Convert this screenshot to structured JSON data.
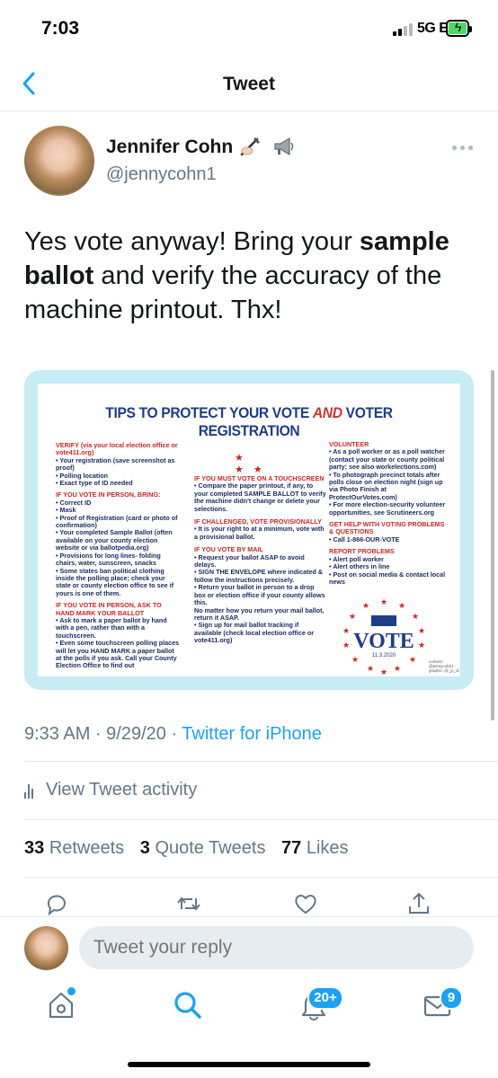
{
  "status_bar": {
    "time": "7:03",
    "network": "5G E"
  },
  "nav": {
    "title": "Tweet"
  },
  "tweet": {
    "author_name": "Jennifer Cohn",
    "author_handle": "@jennycohn1",
    "text_parts": [
      "Yes vote anyway!  Bring your ",
      "sample ballot",
      " and verify the accuracy of the machine printout. Thx!"
    ]
  },
  "image": {
    "title_part1": "TIPS TO PROTECT YOUR VOTE ",
    "title_and": "AND",
    "title_part2": " VOTER REGISTRATION",
    "col1": {
      "verify_head": "VERIFY (via your local election office or vote411.org)",
      "verify_items": [
        "•  Your registration (save screenshot as proof)",
        "•  Polling location",
        "•  Exact type of ID needed"
      ],
      "inperson_head": "IF YOU VOTE IN PERSON, BRING:",
      "inperson_items": [
        "•  Correct ID",
        "•  Mask",
        "•  Proof of Registration (card or photo of confirmation)",
        "•  Your completed Sample Ballot (often available on your county election website or via ballotpedia.org)",
        "•  Provisions for long lines- folding chairs, water, sunscreen, snacks",
        "•  Some states ban political clothing inside the polling place; check your state or county election office to see if yours is one of them."
      ],
      "handmark_head": "IF YOU VOTE IN PERSON, ASK TO HAND MARK YOUR BALLOT",
      "handmark_items": [
        "•  Ask to mark a paper ballot by hand with a pen, rather than with a touchscreen.",
        "•  Even some touchscreen polling places will let you HAND MARK a paper ballot at the polls if you ask. Call your County Election Office to find out"
      ]
    },
    "col2": {
      "touch_head": "IF YOU MUST VOTE ON A TOUCHSCREEN",
      "touch_items": [
        "•  Compare the paper printout, if any, to your completed SAMPLE BALLOT to verify the machine didn't change or delete your selections."
      ],
      "challenged_head": "IF CHALLENGED, VOTE PROVISIONALLY",
      "challenged_items": [
        "•  It is your right to at a minimum, vote with a provisional ballot."
      ],
      "mail_head": "IF YOU VOTE BY MAIL",
      "mail_items": [
        "•  Request your ballot ASAP to avoid delays.",
        "•  SIGN THE ENVELOPE where indicated & follow the instructions precisely.",
        "•  Return your ballot in person to a drop box or election office if your county allows this.",
        "No matter how you return your mail ballot, return it ASAP.",
        "•  Sign up for mail ballot tracking if available (check local election office or vote411.org)"
      ]
    },
    "col3": {
      "volunteer_head": "VOLUNTEER",
      "volunteer_items": [
        "•  As a poll worker or as a poll watcher (contact your state or county political party; see also workelections.com)",
        "•  To photograph precinct totals after polls close on election night (sign up via Photo Finish at ProtectOurVotes.com)",
        "•  For more election-security volunteer opportunities, see Scrutineers.org"
      ],
      "help_head": "GET HELP WITH VOTING PROBLEMS & QUESTIONS",
      "help_items": [
        "•  Call 1-866-OUR-VOTE"
      ],
      "report_head": "REPORT PROBLEMS",
      "report_items": [
        "•  Alert poll worker",
        "•  Alert others in line",
        "•  Post on social media & contact local news"
      ]
    },
    "logo_text": "VOTE",
    "logo_date": "11.3.2020",
    "credit": "content: @jennycohn1 graphic: @_jc_di"
  },
  "meta": {
    "time": "9:33 AM · 9/29/20 · ",
    "source": "Twitter for iPhone"
  },
  "activity_label": "View Tweet activity",
  "stats": {
    "retweets": "33",
    "retweets_label": "Retweets",
    "quotes": "3",
    "quotes_label": "Quote Tweets",
    "likes": "77",
    "likes_label": "Likes"
  },
  "reply": {
    "placeholder": "Tweet your reply"
  },
  "tabs": {
    "notifications_badge": "20+",
    "messages_badge": "9"
  },
  "colors": {
    "accent": "#1da1f2",
    "image_frame": "#c7ecf3",
    "title_blue": "#1f3c86",
    "heading_red": "#c62828"
  },
  "icons": [
    "back-chevron-icon",
    "writing-hand-emoji-icon",
    "megaphone-emoji-icon",
    "more-icon",
    "reply-icon",
    "retweet-icon",
    "like-icon",
    "share-icon",
    "home-icon",
    "search-icon",
    "notifications-icon",
    "messages-icon"
  ]
}
